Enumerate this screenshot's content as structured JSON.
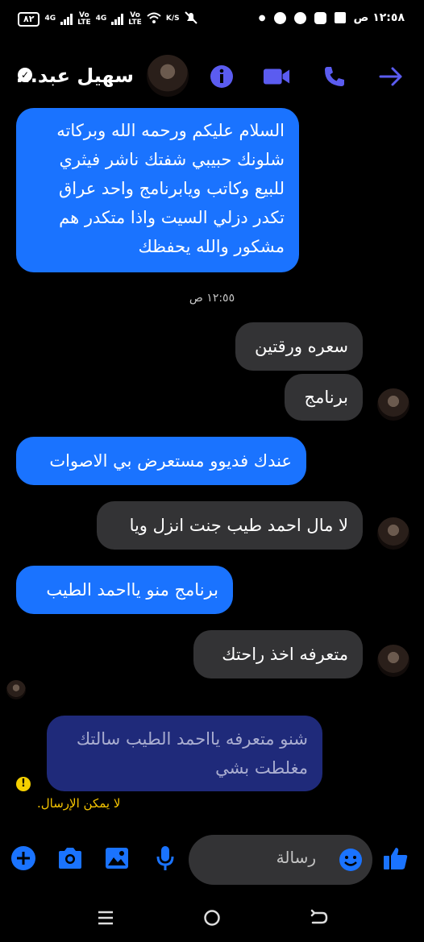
{
  "status_bar": {
    "battery": "٨٢",
    "net1": "4G",
    "volte1": "Vo\nLTE",
    "net2": "4G",
    "volte2": "Vo\nLTE",
    "speed": "K/S",
    "time": "١٢:٥٨ ص"
  },
  "header": {
    "contact_name": "سهيل عبد...",
    "accent_color": "#5b5cf0"
  },
  "messages": [
    {
      "id": "m1",
      "sender": "me",
      "text": "السلام عليكم ورحمه الله وبركاته\nشلونك حبيبي شفتك ناشر فيثري\nللبيع وكاتب ويابرنامج  واحد عراق\nتكدر دزلي السيت واذا متكدر هم\nمشكور والله يحفظك"
    },
    {
      "id": "m2",
      "sender": "them",
      "text": "سعره ورقتين"
    },
    {
      "id": "m3",
      "sender": "them",
      "text": "برنامج"
    },
    {
      "id": "m4",
      "sender": "me",
      "text": "عندك فديوو مستعرض بي الاصوات"
    },
    {
      "id": "m5",
      "sender": "them",
      "text": "لا مال احمد طيب جنت انزل ويا"
    },
    {
      "id": "m6",
      "sender": "me",
      "text": "برنامج منو يااحمد الطيب"
    },
    {
      "id": "m7",
      "sender": "them",
      "text": "متعرفه اخذ راحتك"
    },
    {
      "id": "m8",
      "sender": "me",
      "status": "failed",
      "text": "شنو متعرفه يااحمد الطيب سالتك\nمغلطت بشي"
    }
  ],
  "timestamp": "١٢:٥٥ ص",
  "error_text": "لا يمكن الإرسال.",
  "composer": {
    "placeholder": "رسالة"
  }
}
